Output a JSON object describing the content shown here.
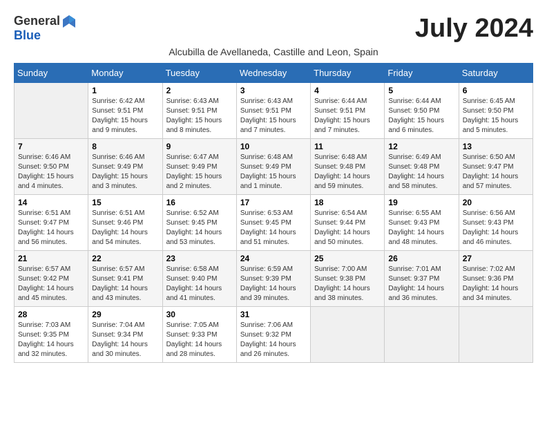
{
  "header": {
    "logo_general": "General",
    "logo_blue": "Blue",
    "month_title": "July 2024",
    "subtitle": "Alcubilla de Avellaneda, Castille and Leon, Spain"
  },
  "days_of_week": [
    "Sunday",
    "Monday",
    "Tuesday",
    "Wednesday",
    "Thursday",
    "Friday",
    "Saturday"
  ],
  "weeks": [
    [
      {
        "day": "",
        "info": ""
      },
      {
        "day": "1",
        "info": "Sunrise: 6:42 AM\nSunset: 9:51 PM\nDaylight: 15 hours\nand 9 minutes."
      },
      {
        "day": "2",
        "info": "Sunrise: 6:43 AM\nSunset: 9:51 PM\nDaylight: 15 hours\nand 8 minutes."
      },
      {
        "day": "3",
        "info": "Sunrise: 6:43 AM\nSunset: 9:51 PM\nDaylight: 15 hours\nand 7 minutes."
      },
      {
        "day": "4",
        "info": "Sunrise: 6:44 AM\nSunset: 9:51 PM\nDaylight: 15 hours\nand 7 minutes."
      },
      {
        "day": "5",
        "info": "Sunrise: 6:44 AM\nSunset: 9:50 PM\nDaylight: 15 hours\nand 6 minutes."
      },
      {
        "day": "6",
        "info": "Sunrise: 6:45 AM\nSunset: 9:50 PM\nDaylight: 15 hours\nand 5 minutes."
      }
    ],
    [
      {
        "day": "7",
        "info": "Sunrise: 6:46 AM\nSunset: 9:50 PM\nDaylight: 15 hours\nand 4 minutes."
      },
      {
        "day": "8",
        "info": "Sunrise: 6:46 AM\nSunset: 9:49 PM\nDaylight: 15 hours\nand 3 minutes."
      },
      {
        "day": "9",
        "info": "Sunrise: 6:47 AM\nSunset: 9:49 PM\nDaylight: 15 hours\nand 2 minutes."
      },
      {
        "day": "10",
        "info": "Sunrise: 6:48 AM\nSunset: 9:49 PM\nDaylight: 15 hours\nand 1 minute."
      },
      {
        "day": "11",
        "info": "Sunrise: 6:48 AM\nSunset: 9:48 PM\nDaylight: 14 hours\nand 59 minutes."
      },
      {
        "day": "12",
        "info": "Sunrise: 6:49 AM\nSunset: 9:48 PM\nDaylight: 14 hours\nand 58 minutes."
      },
      {
        "day": "13",
        "info": "Sunrise: 6:50 AM\nSunset: 9:47 PM\nDaylight: 14 hours\nand 57 minutes."
      }
    ],
    [
      {
        "day": "14",
        "info": "Sunrise: 6:51 AM\nSunset: 9:47 PM\nDaylight: 14 hours\nand 56 minutes."
      },
      {
        "day": "15",
        "info": "Sunrise: 6:51 AM\nSunset: 9:46 PM\nDaylight: 14 hours\nand 54 minutes."
      },
      {
        "day": "16",
        "info": "Sunrise: 6:52 AM\nSunset: 9:45 PM\nDaylight: 14 hours\nand 53 minutes."
      },
      {
        "day": "17",
        "info": "Sunrise: 6:53 AM\nSunset: 9:45 PM\nDaylight: 14 hours\nand 51 minutes."
      },
      {
        "day": "18",
        "info": "Sunrise: 6:54 AM\nSunset: 9:44 PM\nDaylight: 14 hours\nand 50 minutes."
      },
      {
        "day": "19",
        "info": "Sunrise: 6:55 AM\nSunset: 9:43 PM\nDaylight: 14 hours\nand 48 minutes."
      },
      {
        "day": "20",
        "info": "Sunrise: 6:56 AM\nSunset: 9:43 PM\nDaylight: 14 hours\nand 46 minutes."
      }
    ],
    [
      {
        "day": "21",
        "info": "Sunrise: 6:57 AM\nSunset: 9:42 PM\nDaylight: 14 hours\nand 45 minutes."
      },
      {
        "day": "22",
        "info": "Sunrise: 6:57 AM\nSunset: 9:41 PM\nDaylight: 14 hours\nand 43 minutes."
      },
      {
        "day": "23",
        "info": "Sunrise: 6:58 AM\nSunset: 9:40 PM\nDaylight: 14 hours\nand 41 minutes."
      },
      {
        "day": "24",
        "info": "Sunrise: 6:59 AM\nSunset: 9:39 PM\nDaylight: 14 hours\nand 39 minutes."
      },
      {
        "day": "25",
        "info": "Sunrise: 7:00 AM\nSunset: 9:38 PM\nDaylight: 14 hours\nand 38 minutes."
      },
      {
        "day": "26",
        "info": "Sunrise: 7:01 AM\nSunset: 9:37 PM\nDaylight: 14 hours\nand 36 minutes."
      },
      {
        "day": "27",
        "info": "Sunrise: 7:02 AM\nSunset: 9:36 PM\nDaylight: 14 hours\nand 34 minutes."
      }
    ],
    [
      {
        "day": "28",
        "info": "Sunrise: 7:03 AM\nSunset: 9:35 PM\nDaylight: 14 hours\nand 32 minutes."
      },
      {
        "day": "29",
        "info": "Sunrise: 7:04 AM\nSunset: 9:34 PM\nDaylight: 14 hours\nand 30 minutes."
      },
      {
        "day": "30",
        "info": "Sunrise: 7:05 AM\nSunset: 9:33 PM\nDaylight: 14 hours\nand 28 minutes."
      },
      {
        "day": "31",
        "info": "Sunrise: 7:06 AM\nSunset: 9:32 PM\nDaylight: 14 hours\nand 26 minutes."
      },
      {
        "day": "",
        "info": ""
      },
      {
        "day": "",
        "info": ""
      },
      {
        "day": "",
        "info": ""
      }
    ]
  ]
}
